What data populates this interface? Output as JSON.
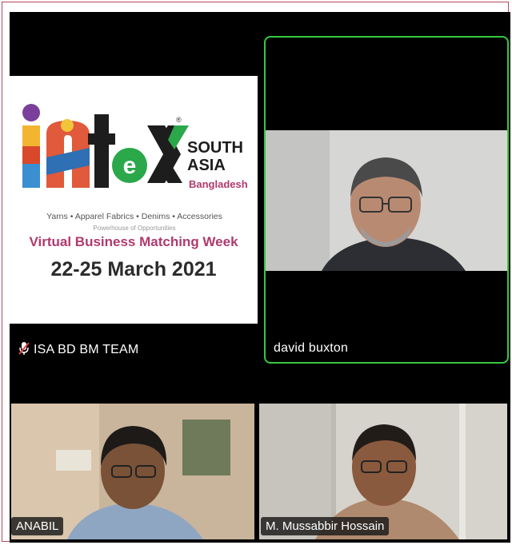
{
  "shared_screen": {
    "participant_name": "ISA BD BM TEAM",
    "muted": true,
    "poster": {
      "logo_text": "intex",
      "logo_registered": "®",
      "logo_region_line1": "SOUTH",
      "logo_region_line2": "ASIA",
      "logo_country": "Bangladesh",
      "tagline": "Yarns • Apparel Fabrics • Denims • Accessories",
      "subtagline": "Powerhouse of Opportunities",
      "event_title": "Virtual Business Matching Week",
      "event_dates": "22-25 March 2021"
    }
  },
  "active_speaker": {
    "name": "david buxton",
    "highlight_color": "#36c83f"
  },
  "participants": [
    {
      "name": "ANABIL"
    },
    {
      "name": "M. Mussabbir Hossain"
    }
  ],
  "colors": {
    "frame_border": "#b5485e",
    "event_title": "#b03a6e",
    "logo_green": "#2aa84a"
  }
}
